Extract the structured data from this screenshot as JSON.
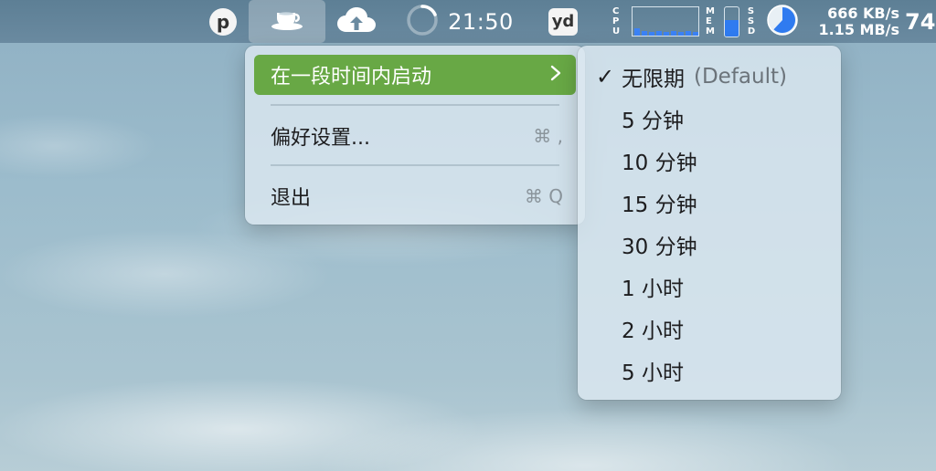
{
  "menubar": {
    "p_badge": "p",
    "clock": "21:50",
    "yd_badge": "yd",
    "cpu_label": [
      "C",
      "P",
      "U"
    ],
    "mem_label": [
      "M",
      "E",
      "M"
    ],
    "ssd_label": [
      "S",
      "S",
      "D"
    ],
    "net_up": "666 KB/s",
    "net_down": "1.15 MB/s",
    "right_partial": "74",
    "mem_usage": 0.55,
    "ssd_usage": 0.62,
    "icons": [
      "coffee-cup-icon",
      "cloud-upload-icon",
      "progress-ring-icon"
    ],
    "accent": "#3b82f6"
  },
  "main_menu": {
    "items": [
      {
        "label": "在一段时间内启动",
        "shortcut": "",
        "submenu": true
      },
      {
        "label": "偏好设置...",
        "shortcut": "⌘ ,"
      },
      {
        "label": "退出",
        "shortcut": "⌘ Q"
      }
    ],
    "highlight_color": "#68a845"
  },
  "submenu": {
    "items": [
      {
        "label": "无限期",
        "suffix": "(Default)",
        "checked": true
      },
      {
        "label": "5 分钟"
      },
      {
        "label": "10 分钟"
      },
      {
        "label": "15 分钟"
      },
      {
        "label": "30 分钟"
      },
      {
        "label": "1 小时"
      },
      {
        "label": "2 小时"
      },
      {
        "label": "5 小时"
      }
    ],
    "check_mark": "✓"
  }
}
